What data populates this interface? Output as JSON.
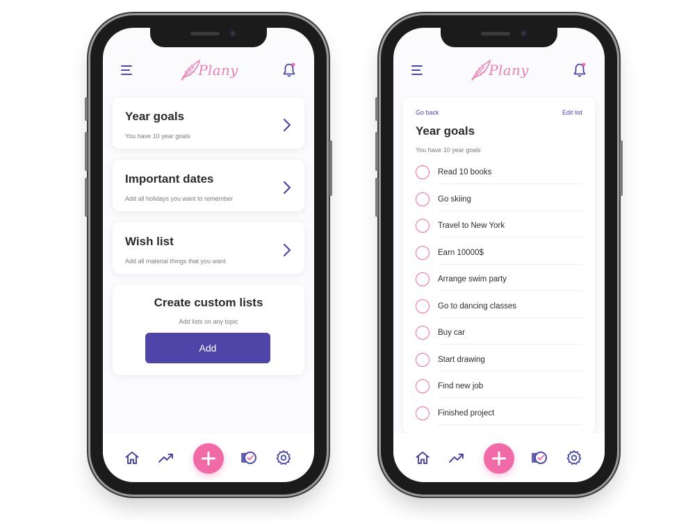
{
  "app": {
    "logo_text": "Plany",
    "accent": "#4d45a8",
    "pink": "#f06aa8"
  },
  "left_screen": {
    "cards": [
      {
        "title": "Year goals",
        "subtitle": "You have 10 year goals"
      },
      {
        "title": "Important dates",
        "subtitle": "Add all holidays you want to remember"
      },
      {
        "title": "Wish list",
        "subtitle": "Add all material things that you want"
      }
    ],
    "custom": {
      "title": "Create custom lists",
      "subtitle": "Add lists on any topic",
      "button": "Add"
    }
  },
  "right_screen": {
    "go_back": "Go back",
    "edit_list": "Edit list",
    "title": "Year goals",
    "subtitle": "You have 10 year goals",
    "goals": [
      "Read 10 books",
      "Go skiing",
      "Travel to New York",
      "Earn 10000$",
      "Arrange swim party",
      "Go to dancing classes",
      "Buy car",
      "Start drawing",
      "Find new job",
      "Finished project"
    ]
  },
  "nav": {
    "icons": [
      "home-icon",
      "trending-up-icon",
      "add-icon",
      "checklist-icon",
      "settings-icon"
    ]
  }
}
